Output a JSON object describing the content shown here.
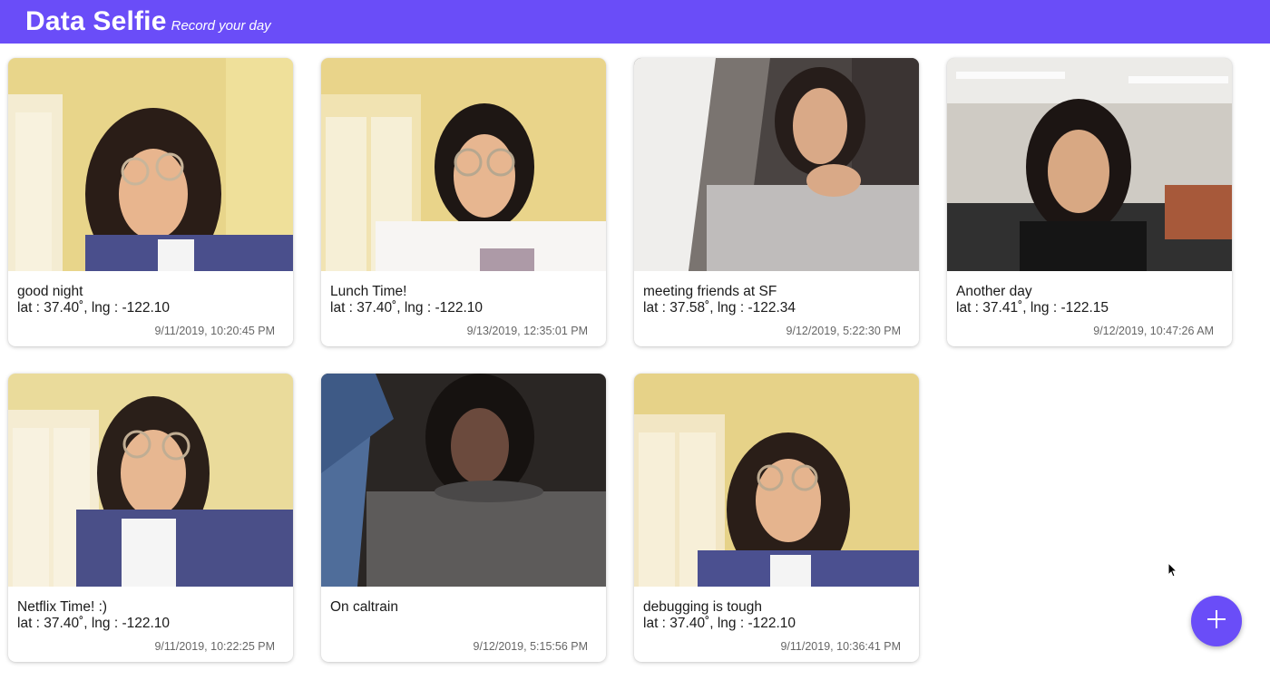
{
  "header": {
    "title": "Data Selfie",
    "subtitle": "Record your day"
  },
  "cards": [
    {
      "caption": "good night",
      "location": "lat : 37.40˚, lng : -122.10",
      "timestamp": "9/11/2019, 10:20:45 PM"
    },
    {
      "caption": "Lunch Time!",
      "location": "lat : 37.40˚, lng : -122.10",
      "timestamp": "9/13/2019, 12:35:01 PM"
    },
    {
      "caption": "meeting friends at SF",
      "location": "lat : 37.58˚, lng : -122.34",
      "timestamp": "9/12/2019, 5:22:30 PM"
    },
    {
      "caption": "Another day",
      "location": "lat : 37.41˚, lng : -122.15",
      "timestamp": "9/12/2019, 10:47:26 AM"
    },
    {
      "caption": "Netflix Time! :)",
      "location": "lat : 37.40˚, lng : -122.10",
      "timestamp": "9/11/2019, 10:22:25 PM"
    },
    {
      "caption": "On caltrain",
      "location": "",
      "timestamp": "9/12/2019, 5:15:56 PM"
    },
    {
      "caption": "debugging is tough",
      "location": "lat : 37.40˚, lng : -122.10",
      "timestamp": "9/11/2019, 10:36:41 PM"
    }
  ],
  "fab": {
    "icon": "plus-icon"
  },
  "colors": {
    "accent": "#6a4df8"
  }
}
